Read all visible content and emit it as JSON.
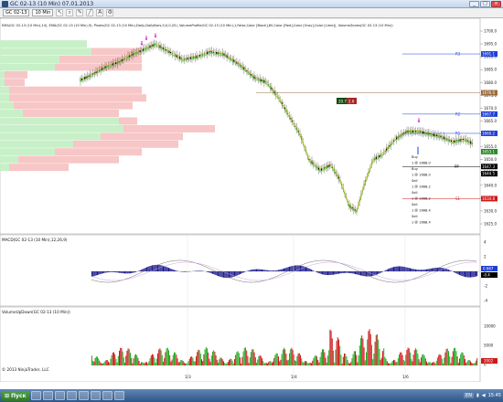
{
  "window": {
    "title": "GC 02-13 (10 Min)  07.01.2013",
    "buttons": [
      "_",
      "□",
      "×"
    ]
  },
  "toolbar": {
    "instrument": "GC 02-13",
    "interval": "10 Min",
    "icons": [
      "cursor-icon",
      "zoom-icon",
      "draw-icon",
      "line-icon",
      "text-icon",
      "properties-icon"
    ]
  },
  "chart": {
    "indicator_label": "EMA(GC 02-13 (10 Min),14), EMA(GC 02-13 (10 Min),9), Pivots(GC 02-13 (10 Min),Daily,DailyBars,0,0,0,20), VolumeProfile(GC 02-13 (10 Min),1,False,Color [Black],60,Color [Red],Color [Gray],Color [Lime]), VolumeZones(GC 02-13 (10 Min))",
    "price_ticks": [
      "1700.0",
      "1695.0",
      "1690.0",
      "1685.0",
      "1680.0",
      "1675.0",
      "1670.0",
      "1665.0",
      "1660.0",
      "1655.0",
      "1650.0",
      "1645.0",
      "1640.0",
      "1635.0",
      "1630.0",
      "1625.0"
    ],
    "price_markers": [
      {
        "label": "1691.1",
        "color": "#1e3fd6"
      },
      {
        "label": "1676.0",
        "color": "#9a6a3a"
      },
      {
        "label": "1667.7",
        "color": "#1e3fd6"
      },
      {
        "label": "1660.2",
        "color": "#1e3fd6"
      },
      {
        "label": "1653.1",
        "color": "#2a8a2a"
      },
      {
        "label": "1647.3",
        "color": "#000000"
      },
      {
        "label": "1644.5",
        "color": "#000000"
      },
      {
        "label": "1634.8",
        "color": "#d01818"
      }
    ],
    "pivot_labels": [
      "R3",
      "R2",
      "R1",
      "PP",
      "S1"
    ],
    "position_box": {
      "left": "20.7",
      "right": "2.6"
    },
    "trade_labels": [
      "Buy",
      "1 @ 1668.0",
      "Buy",
      "1 @ 1668.0",
      "Sell",
      "1 @ 1668.2",
      "Sell",
      "1 @ 1668.2",
      "Sell",
      "1 @ 1668.4",
      "Sell",
      "1 @ 1668.4"
    ],
    "date_labels": [
      "1/3",
      "1/4",
      "1/6"
    ],
    "copyright": "© 2013 NinjaTrader, LLC"
  },
  "macd": {
    "label": "MACD(GC 02-13 (10 Min),12,26,9)",
    "ticks": [
      "4",
      "2",
      "0",
      "-2",
      "-4"
    ],
    "marker_a": "0.667",
    "marker_b": "-0.4"
  },
  "volume": {
    "label": "VolumeUpDown(GC 02-13 (10 Min))",
    "ticks": [
      "10000",
      "5000",
      "0"
    ],
    "marker": "2002"
  },
  "taskbar": {
    "start_label": "Пуск",
    "language": "EN",
    "clock": "15:45"
  },
  "colors": {
    "up_candle": "#2aa02a",
    "down_candle": "#000000",
    "ema_fast": "#7fc542",
    "macd_hist": "#1a1a8c",
    "volume_up": "#22aa22",
    "volume_down": "#cc1a1a",
    "profile_green": "#c8f0c8",
    "profile_red": "#f7c6c6"
  }
}
